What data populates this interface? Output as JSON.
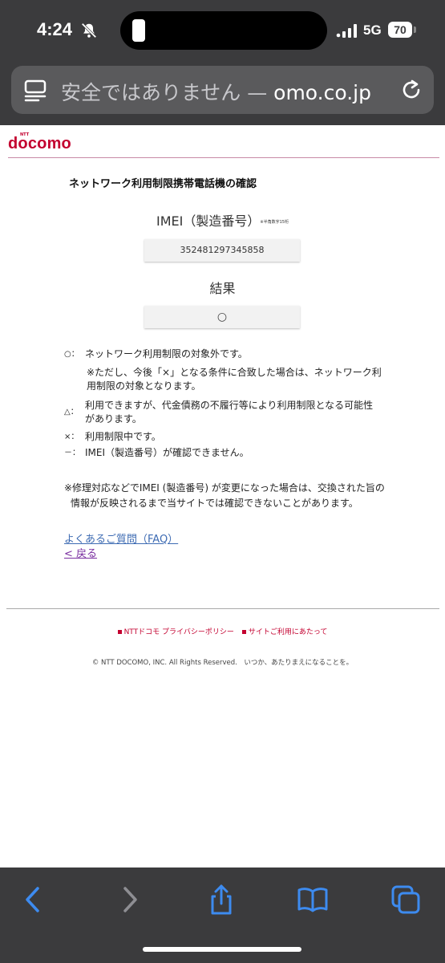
{
  "status_bar": {
    "time": "4:24",
    "network": "5G",
    "battery": "70"
  },
  "address_bar": {
    "security_warning": "安全ではありません — ",
    "domain": "omo.co.jp"
  },
  "header": {
    "logo_ntt": "NTT",
    "logo_text": "docomo"
  },
  "content": {
    "page_title": "ネットワーク利用制限携帯電話機の確認",
    "imei_label": "IMEI（製造番号）",
    "imei_note": "※半角数字15桁",
    "imei_value": "352481297345858",
    "result_label": "結果",
    "result_value": "○",
    "legend": [
      {
        "mark": "○：",
        "text": "ネットワーク利用制限の対象外です。"
      },
      {
        "mark": "△：",
        "text": "利用できますが、代金債務の不履行等により利用制限となる可能性があります。"
      },
      {
        "mark": "×：",
        "text": "利用制限中です。"
      },
      {
        "mark": "－：",
        "text": "IMEI（製造番号）が確認できません。"
      }
    ],
    "circle_sub_note": "※ただし、今後「×」となる条件に合致した場合は、ネットワーク利用制限の対象となります。",
    "repair_note": "※修理対応などでIMEI (製造番号) が変更になった場合は、交換された旨の情報が反映されるまで当サイトでは確認できないことがあります。",
    "faq_link": "よくあるご質問（FAQ）",
    "back_link": "< 戻る"
  },
  "footer": {
    "privacy_link": "NTTドコモ プライバシーポリシー",
    "terms_link": "サイトご利用にあたって",
    "copyright": "© NTT DOCOMO, INC. All Rights Reserved.　いつか、あたりまえになることを。"
  },
  "colors": {
    "brand": "#c3002f",
    "chrome": "#3b3b3d",
    "link": "#3d6bb3",
    "icon_blue": "#3d8bf0"
  }
}
